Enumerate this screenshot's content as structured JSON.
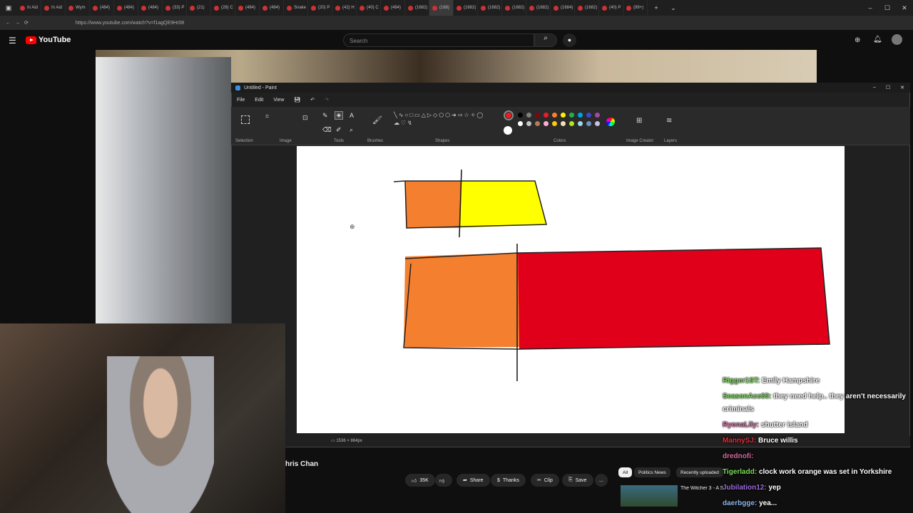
{
  "browser": {
    "tabs": [
      {
        "label": "In Aid",
        "active": false
      },
      {
        "label": "In Aid",
        "active": false
      },
      {
        "label": "Wym",
        "active": false
      },
      {
        "label": "(484)",
        "active": false
      },
      {
        "label": "(484)",
        "active": false
      },
      {
        "label": "(484)",
        "active": false
      },
      {
        "label": "(33) P",
        "active": false
      },
      {
        "label": "(21)",
        "active": false
      },
      {
        "label": "(28) C",
        "active": false
      },
      {
        "label": "(484)",
        "active": false
      },
      {
        "label": "(484)",
        "active": false
      },
      {
        "label": "Snake",
        "active": false
      },
      {
        "label": "(20) P",
        "active": false
      },
      {
        "label": "(42) H",
        "active": false
      },
      {
        "label": "(40) C",
        "active": false
      },
      {
        "label": "(484)",
        "active": false
      },
      {
        "label": "(1682)",
        "active": false
      },
      {
        "label": "(168)",
        "active": true
      },
      {
        "label": "(1682)",
        "active": false
      },
      {
        "label": "(1682)",
        "active": false
      },
      {
        "label": "(1682)",
        "active": false
      },
      {
        "label": "(1682)",
        "active": false
      },
      {
        "label": "(1684)",
        "active": false
      },
      {
        "label": "(1682)",
        "active": false
      },
      {
        "label": "(40) P",
        "active": false
      },
      {
        "label": "(99+)",
        "active": false
      }
    ],
    "url": "https://www.youtube.com/watch?v=f1agQE9Hr08"
  },
  "youtube": {
    "logo": "YouTube",
    "search_placeholder": "Search",
    "channel_name": "hris Chan",
    "like_count": "35K",
    "share_label": "Share",
    "thanks_label": "Thanks",
    "clip_label": "Clip",
    "save_label": "Save",
    "more_label": "...",
    "chips": [
      {
        "label": "All",
        "selected": true
      },
      {
        "label": "Politics News",
        "selected": false
      },
      {
        "label": "Recently uploaded",
        "selected": false
      }
    ],
    "recommended_title": "The Witcher 3 - A S"
  },
  "paint": {
    "title": "Untitled - Paint",
    "menu": [
      "File",
      "Edit",
      "View"
    ],
    "groups": [
      "Selection",
      "Image",
      "Tools",
      "Brushes",
      "Shapes",
      "Colors",
      "Image Creator",
      "Layers"
    ],
    "canvas_size": "1536 × 864px",
    "palette_row1": [
      "#000000",
      "#7f7f7f",
      "#880015",
      "#ed1c24",
      "#ff7f27",
      "#fff200",
      "#22b14c",
      "#00a2e8",
      "#3f48cc",
      "#a349a4"
    ],
    "palette_row2": [
      "#ffffff",
      "#c3c3c3",
      "#b97a57",
      "#ffaec9",
      "#ffc90e",
      "#efe4b0",
      "#b5e61d",
      "#99d9ea",
      "#7092be",
      "#c8bfe7"
    ],
    "primary_color": "#ed1c24",
    "secondary_color": "#ffffff",
    "drawing_colors": {
      "orange": "#f47f2f",
      "yellow": "#ffff00",
      "red": "#e0001a"
    }
  },
  "chat": [
    {
      "user": "Rigger1ST:",
      "text": "Emily Hampshire",
      "color": "#7ddc5c"
    },
    {
      "user": "SeasonAce69:",
      "text": "they need help.. they aren't necessarily criminals",
      "color": "#7ddc5c"
    },
    {
      "user": "RyonaLily:",
      "text": "shutter island",
      "color": "#d46ba0"
    },
    {
      "user": "MannySJ:",
      "text": "Bruce willis",
      "color": "#e0303a"
    },
    {
      "user": "drednofi:",
      "text": "",
      "color": "#d46ba0"
    },
    {
      "user": "Tigerladd:",
      "text": "clock work orange was set in Yorkshire",
      "color": "#7ddc5c"
    },
    {
      "user": "Jubilation12:",
      "text": "yep",
      "color": "#9b6ad6"
    },
    {
      "user": "daerbgge:",
      "text": "yea...",
      "color": "#8fb4e8"
    }
  ]
}
